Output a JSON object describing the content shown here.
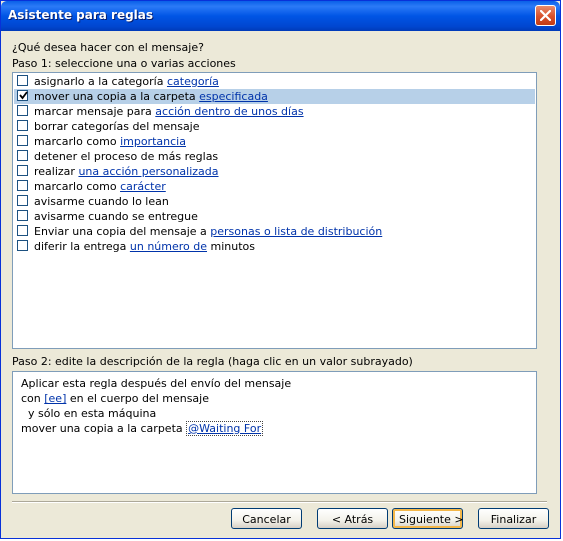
{
  "window": {
    "title": "Asistente para reglas"
  },
  "prompt": "¿Qué desea hacer con el mensaje?",
  "step1": {
    "label": "Paso 1: seleccione una o varias acciones",
    "items": [
      {
        "pre": "asignarlo a la categoría ",
        "link": "categoría",
        "post": "",
        "checked": false
      },
      {
        "pre": "mover una copia a la carpeta ",
        "link": "especificada",
        "post": "",
        "checked": true
      },
      {
        "pre": "marcar mensaje para ",
        "link": "acción dentro de unos días",
        "post": "",
        "checked": false
      },
      {
        "pre": "borrar categorías del mensaje",
        "link": "",
        "post": "",
        "checked": false
      },
      {
        "pre": "marcarlo como ",
        "link": "importancia",
        "post": "",
        "checked": false
      },
      {
        "pre": "detener el proceso de más reglas",
        "link": "",
        "post": "",
        "checked": false
      },
      {
        "pre": "realizar ",
        "link": "una acción personalizada",
        "post": "",
        "checked": false
      },
      {
        "pre": "marcarlo como ",
        "link": "carácter",
        "post": "",
        "checked": false
      },
      {
        "pre": "avisarme cuando lo lean",
        "link": "",
        "post": "",
        "checked": false
      },
      {
        "pre": "avisarme cuando se entregue",
        "link": "",
        "post": "",
        "checked": false
      },
      {
        "pre": "Enviar una copia del mensaje a ",
        "link": "personas o lista de distribución",
        "post": "",
        "checked": false
      },
      {
        "pre": "diferir la entrega ",
        "link": "un número de",
        "post": " minutos",
        "checked": false
      }
    ]
  },
  "step2": {
    "label": "Paso 2: edite la descripción de la regla (haga clic en un valor subrayado)",
    "lines": [
      {
        "pre": "Aplicar esta regla después del envío del mensaje",
        "link": "",
        "post": ""
      },
      {
        "pre": "con ",
        "link": "[ee]",
        "post": " en el cuerpo del mensaje"
      },
      {
        "pre": "  y sólo en esta máquina",
        "link": "",
        "post": ""
      },
      {
        "pre": "mover una copia a la carpeta ",
        "link": "@Waiting For",
        "post": ""
      }
    ]
  },
  "buttons": {
    "cancel": "Cancelar",
    "back": "< Atrás",
    "next": "Siguiente >",
    "finish": "Finalizar"
  },
  "colors": {
    "titlebar": "#0055e5",
    "selection": "#b7d0e8",
    "link": "#0033aa",
    "dialog": "#ece9d8"
  }
}
